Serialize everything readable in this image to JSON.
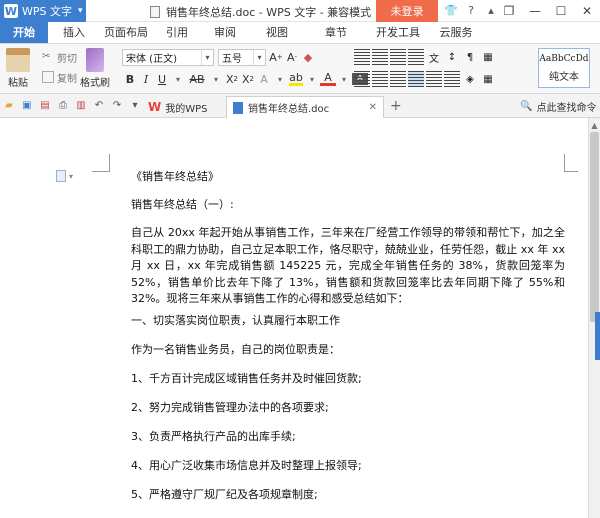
{
  "app": {
    "name": "WPS 文字",
    "logo": "W"
  },
  "window": {
    "title": "销售年终总结.doc - WPS 文字 - 兼容模式",
    "login": "未登录"
  },
  "menu": {
    "tabs": [
      "开始",
      "插入",
      "页面布局",
      "引用",
      "审阅",
      "视图",
      "章节",
      "开发工具",
      "云服务"
    ],
    "active": 0
  },
  "ribbon": {
    "paste": "粘贴",
    "cut": "剪切",
    "copy": "复制",
    "format_painter": "格式刷",
    "font_name": "宋体 (正文)",
    "font_size": "五号",
    "style_sample": "AaBbCcDd",
    "style_name": "纯文本",
    "colors": {
      "highlight": "#f5e600",
      "font_color": "#e8352f",
      "accent": "#3c7fcf"
    }
  },
  "docbar": {
    "tabs": [
      {
        "label": "我的WPS",
        "icon": "wps-logo-icon"
      },
      {
        "label": "销售年终总结.doc",
        "icon": "doc-icon"
      }
    ],
    "find_cmd": "点此查找命令"
  },
  "document": {
    "lines": [
      "《销售年终总结》",
      "销售年终总结（一）:",
      "自己从 20xx 年起开始从事销售工作，三年来在厂经营工作领导的带领和帮忙下，加之全科职工的鼎力协助，自己立足本职工作，恪尽职守，兢兢业业，任劳任怨，截止 xx 年 xx 月 xx 日，xx 年完成销售额 145225 元，完成全年销售任务的 38%，货款回笼率为 52%，销售单价比去年下降了 13%，销售额和货款回笼率比去年同期下降了 55%和 32%。现将三年来从事销售工作的心得和感受总结如下：",
      "一、切实落实岗位职责，认真履行本职工作",
      "作为一名销售业务员，自己的岗位职责是：",
      "1、千方百计完成区域销售任务并及时催回货款;",
      "2、努力完成销售管理办法中的各项要求;",
      "3、负责严格执行产品的出库手续;",
      "4、用心广泛收集市场信息并及时整理上报领导;",
      "5、严格遵守厂规厂纪及各项规章制度;"
    ]
  }
}
